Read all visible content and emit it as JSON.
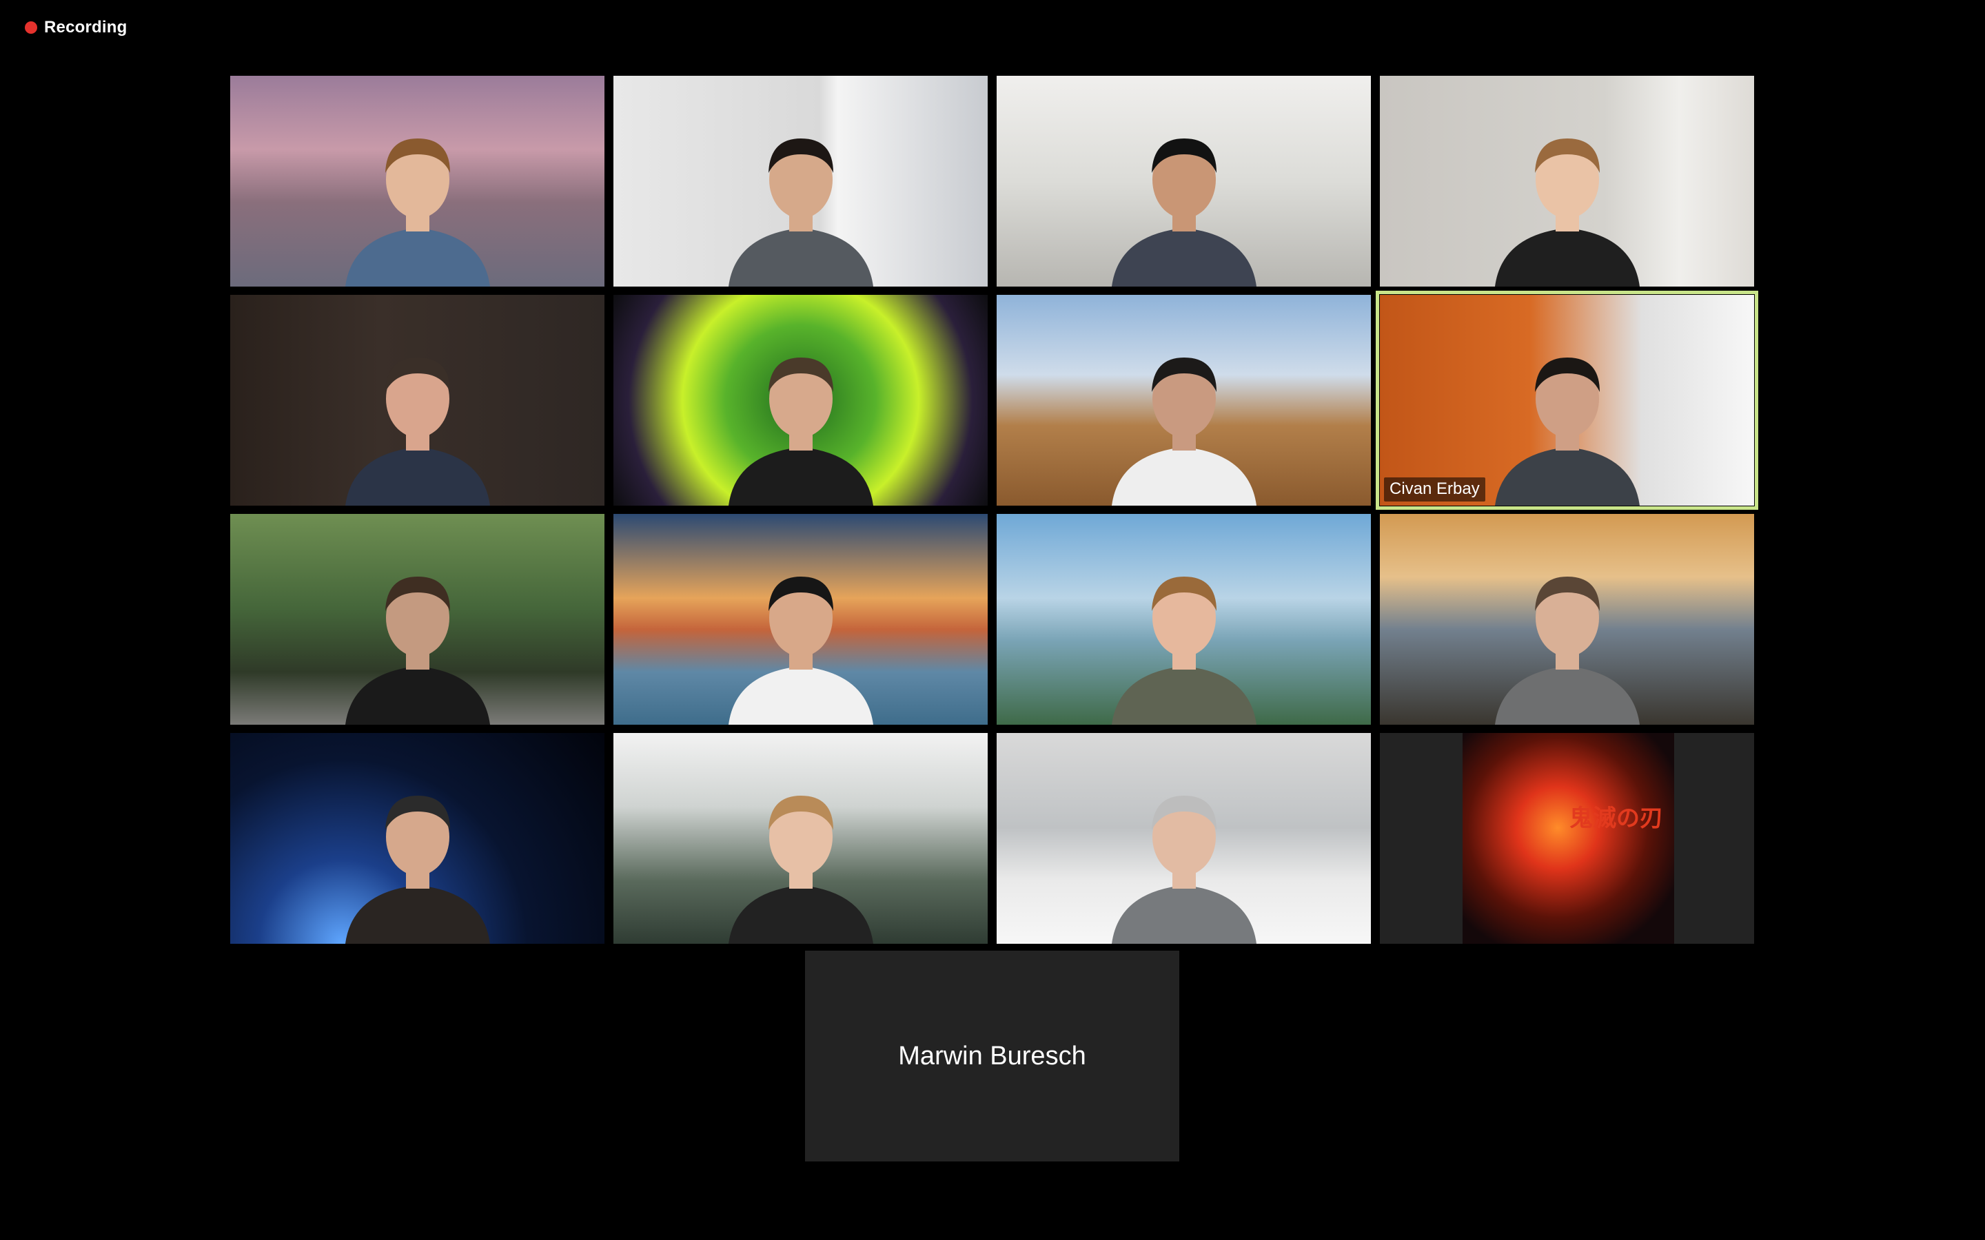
{
  "recording": {
    "label": "Recording",
    "dot_color": "#e5322d"
  },
  "active_speaker_color": "#c9e58a",
  "tiles": [
    {
      "name": "",
      "background": "castle",
      "shirt": "#4d6b8f",
      "hair": "#8a5a2f",
      "skin": "#e3b89a"
    },
    {
      "name": "",
      "background": "window",
      "shirt": "#555a60",
      "hair": "#1d1714",
      "skin": "#d6a98a"
    },
    {
      "name": "",
      "background": "room",
      "shirt": "#3e4452",
      "hair": "#121212",
      "skin": "#c99675"
    },
    {
      "name": "",
      "background": "wall",
      "shirt": "#1f1f1f",
      "hair": "#9a6a3e",
      "skin": "#eac3a6"
    },
    {
      "name": "",
      "background": "library",
      "shirt": "#2b3447",
      "hair": "#3a2f28",
      "skin": "#d9a58d"
    },
    {
      "name": "",
      "background": "portal",
      "shirt": "#1c1c1c",
      "hair": "#4a3a2a",
      "skin": "#d7a98c"
    },
    {
      "name": "",
      "background": "savanna",
      "shirt": "#eeeeee",
      "hair": "#1c1a19",
      "skin": "#c99a80"
    },
    {
      "name": "Civan Erbay",
      "background": "orange",
      "shirt": "#3c4148",
      "hair": "#1b1714",
      "skin": "#cf9f85",
      "active": true
    },
    {
      "name": "",
      "background": "bamboo",
      "shirt": "#1a1a1a",
      "hair": "#3f2e22",
      "skin": "#c49a80"
    },
    {
      "name": "",
      "background": "bridge",
      "shirt": "#f1f1f1",
      "hair": "#161616",
      "skin": "#d8a889"
    },
    {
      "name": "",
      "background": "coast",
      "shirt": "#5f6453",
      "hair": "#9a6a3a",
      "skin": "#e6b89d"
    },
    {
      "name": "",
      "background": "sunset",
      "shirt": "#6e6f70",
      "hair": "#5a4636",
      "skin": "#d9b096"
    },
    {
      "name": "",
      "background": "space",
      "shirt": "#2a2522",
      "hair": "#2b2b2b",
      "skin": "#d6a88c"
    },
    {
      "name": "",
      "background": "forest",
      "shirt": "#222222",
      "hair": "#b98b58",
      "skin": "#e7c0a6"
    },
    {
      "name": "",
      "background": "snow",
      "shirt": "#777a7d",
      "hair": "#bdbdbd",
      "skin": "#e2bba3"
    },
    {
      "name": "",
      "background": "anime",
      "glyph": "鬼滅の刃"
    }
  ],
  "bottom_participant": {
    "name": "Marwin Buresch"
  }
}
